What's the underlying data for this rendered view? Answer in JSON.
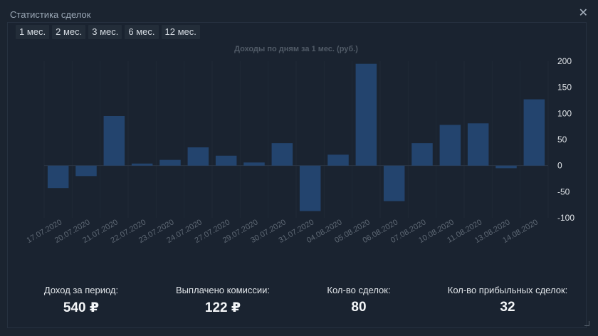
{
  "window": {
    "title": "Статистика сделок",
    "close_glyph": "✕"
  },
  "periods": [
    "1 мес.",
    "2 мес.",
    "3 мес.",
    "6 мес.",
    "12 мес."
  ],
  "chart_data": {
    "type": "bar",
    "title": "Доходы по дням за 1 мес. (руб.)",
    "xlabel": "",
    "ylabel": "",
    "ylim": [
      -100,
      200
    ],
    "yticks": [
      200,
      150,
      100,
      50,
      0,
      -50,
      -100
    ],
    "categories": [
      "17.07.2020",
      "20.07.2020",
      "21.07.2020",
      "22.07.2020",
      "23.07.2020",
      "24.07.2020",
      "27.07.2020",
      "29.07.2020",
      "30.07.2020",
      "31.07.2020",
      "04.08.2020",
      "05.08.2020",
      "06.08.2020",
      "07.08.2020",
      "10.08.2020",
      "11.08.2020",
      "13.08.2020",
      "14.08.2020"
    ],
    "values": [
      -43,
      -20,
      95,
      4,
      11,
      35,
      19,
      6,
      43,
      -87,
      21,
      195,
      -68,
      43,
      78,
      81,
      -5,
      127
    ],
    "bar_color": "#23446e",
    "axis_label_color": "#5d6773",
    "title_color": "#515b67",
    "tick_color": "#e0e4e8"
  },
  "stats": [
    {
      "label": "Доход за период:",
      "value": "540 ₽"
    },
    {
      "label": "Выплачено комиссии:",
      "value": "122 ₽"
    },
    {
      "label": "Кол-во сделок:",
      "value": "80"
    },
    {
      "label": "Кол-во прибыльных сделок:",
      "value": "32"
    }
  ]
}
